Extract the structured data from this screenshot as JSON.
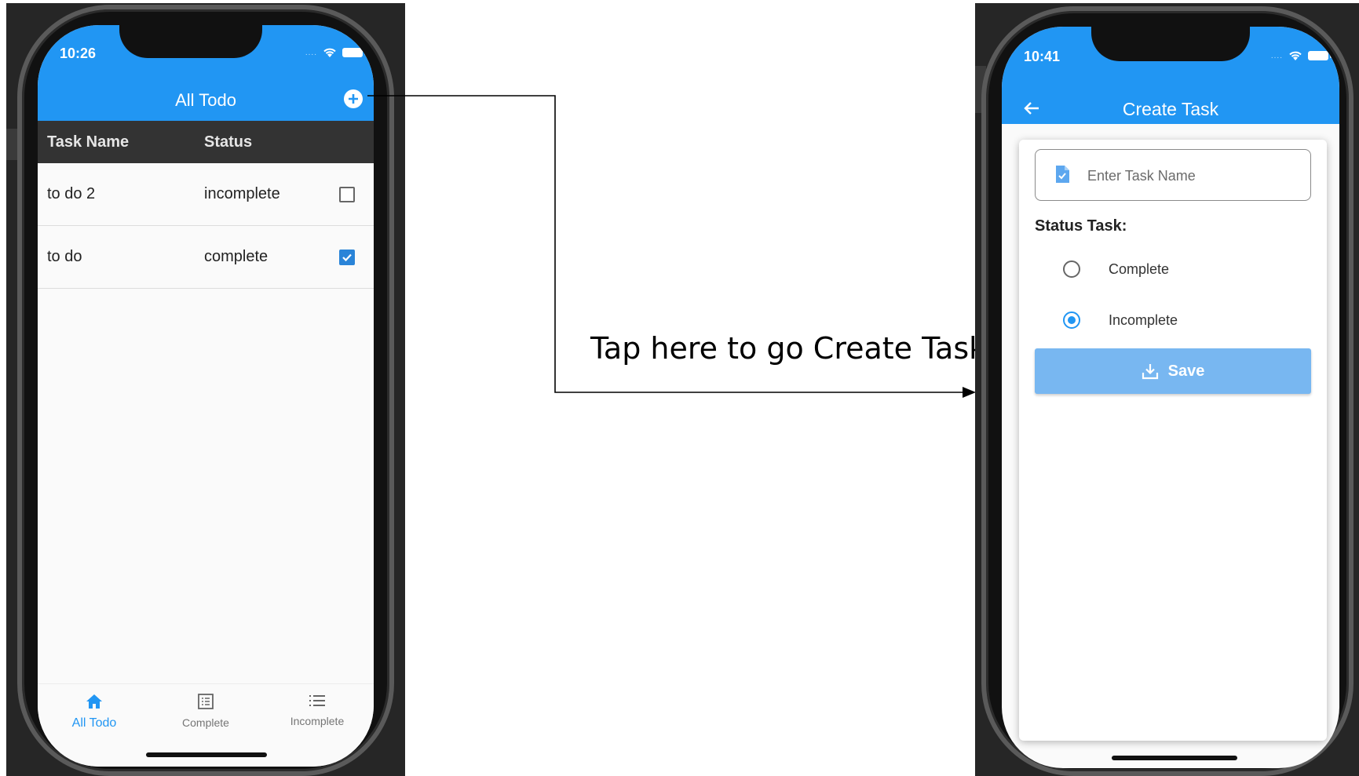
{
  "left_phone": {
    "status_bar": {
      "time": "10:26"
    },
    "app_bar": {
      "title": "All Todo",
      "add_icon": "plus-circle-icon"
    },
    "table": {
      "columns": [
        "Task Name",
        "Status"
      ],
      "rows": [
        {
          "task_name": "to do 2",
          "status": "incomplete",
          "checked": false
        },
        {
          "task_name": "to do",
          "status": "complete",
          "checked": true
        }
      ]
    },
    "bottom_nav": [
      {
        "label": "All Todo",
        "icon": "home-icon",
        "active": true
      },
      {
        "label": "Complete",
        "icon": "list-box-icon",
        "active": false
      },
      {
        "label": "Incomplete",
        "icon": "list-icon",
        "active": false
      }
    ]
  },
  "annotation": {
    "text": "Tap here to go Create Task"
  },
  "right_phone": {
    "status_bar": {
      "time": "10:41"
    },
    "app_bar": {
      "title": "Create Task",
      "back_icon": "arrow-left-icon"
    },
    "form": {
      "task_name_placeholder": "Enter Task Name",
      "task_name_value": "",
      "status_label": "Status Task:",
      "options": [
        {
          "label": "Complete",
          "selected": false
        },
        {
          "label": "Incomplete",
          "selected": true
        }
      ],
      "save_label": "Save",
      "save_icon": "download-icon"
    }
  },
  "colors": {
    "primary": "#2196f3",
    "table_header": "#333333",
    "checkbox_checked": "#2a84d8",
    "save_button": "#78b7f1"
  }
}
